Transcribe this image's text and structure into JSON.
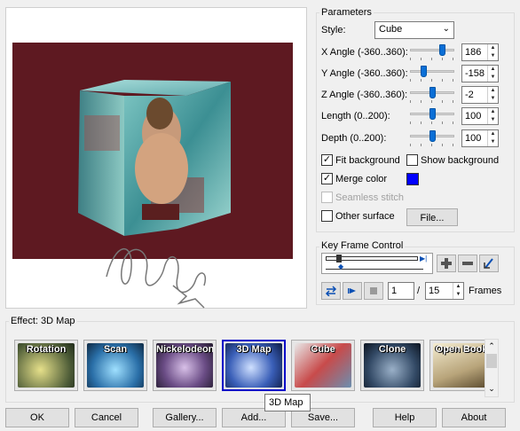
{
  "parameters": {
    "title": "Parameters",
    "style_label": "Style:",
    "style_value": "Cube",
    "x_angle": {
      "label": "X Angle (-360..360):",
      "value": "186",
      "level": 0.76
    },
    "y_angle": {
      "label": "Y Angle (-360..360):",
      "value": "-158",
      "level": 0.28
    },
    "z_angle": {
      "label": "Z Angle (-360..360):",
      "value": "-2",
      "level": 0.5
    },
    "length": {
      "label": "Length (0..200):",
      "value": "100",
      "level": 0.5
    },
    "depth": {
      "label": "Depth (0..200):",
      "value": "100",
      "level": 0.5
    },
    "fit_background": {
      "label": "Fit background",
      "checked": true
    },
    "show_background": {
      "label": "Show background",
      "checked": false
    },
    "merge_color": {
      "label": "Merge color",
      "checked": true,
      "color": "#0000ff"
    },
    "seamless_stitch": {
      "label": "Seamless stitch",
      "checked": false,
      "disabled": true
    },
    "other_surface": {
      "label": "Other surface",
      "checked": false
    },
    "file_button": "File..."
  },
  "keyframe": {
    "title": "Key Frame Control",
    "current_frame": "1",
    "separator": "/",
    "total_frames": "15",
    "frames_label": "Frames"
  },
  "effect": {
    "title": "Effect: 3D Map",
    "items": [
      {
        "label": "Rotation",
        "selected": false
      },
      {
        "label": "Scan",
        "selected": false
      },
      {
        "label": "Nickelodeon",
        "selected": false
      },
      {
        "label": "3D Map",
        "selected": true
      },
      {
        "label": "Cube",
        "selected": false
      },
      {
        "label": "Clone",
        "selected": false
      },
      {
        "label": "Open Book",
        "selected": false
      }
    ],
    "tooltip": "3D Map"
  },
  "buttons": {
    "ok": "OK",
    "cancel": "Cancel",
    "gallery": "Gallery...",
    "add": "Add...",
    "save": "Save...",
    "help": "Help",
    "about": "About"
  },
  "colors": {
    "background": "#5e1921",
    "accent": "#0000c8",
    "merge": "#0000ff"
  }
}
